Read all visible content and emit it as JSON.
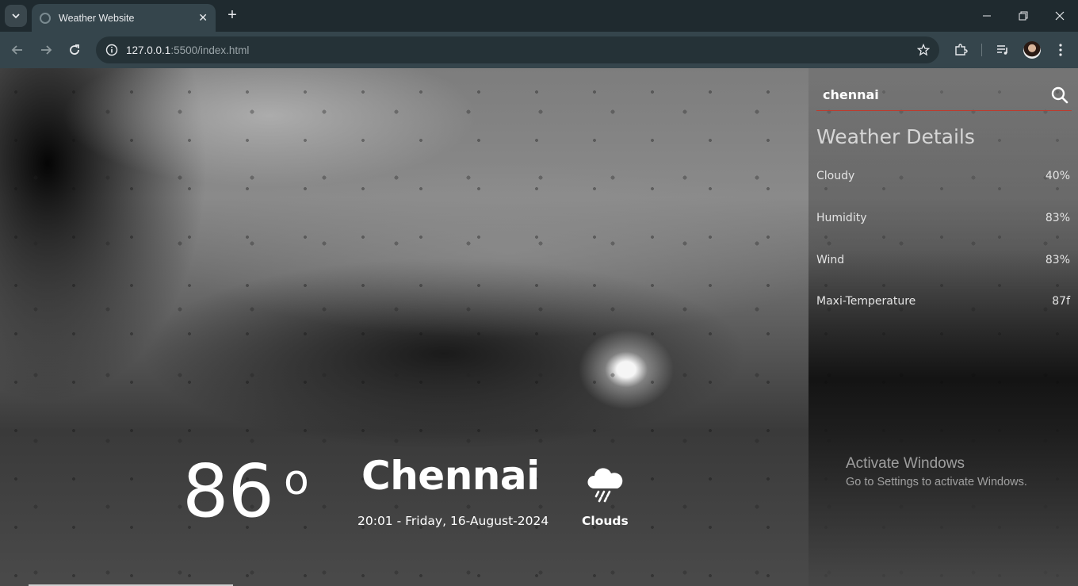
{
  "browser": {
    "tab_title": "Weather Website",
    "url_host": "127.0.0.1",
    "url_rest": ":5500/index.html"
  },
  "weather": {
    "temperature": "86",
    "degree_symbol": "o",
    "city": "Chennai",
    "datetime": "20:01 - Friday, 16-August-2024",
    "condition": "Clouds",
    "condition_icon": "rain-cloud-icon"
  },
  "search": {
    "value": "chennai"
  },
  "details": {
    "title": "Weather Details",
    "rows": [
      {
        "label": "Cloudy",
        "value": "40%"
      },
      {
        "label": "Humidity",
        "value": "83%"
      },
      {
        "label": "Wind",
        "value": "83%"
      },
      {
        "label": "Maxi-Temperature",
        "value": "87f"
      }
    ]
  },
  "watermark": {
    "line1": "Activate Windows",
    "line2": "Go to Settings to activate Windows."
  }
}
